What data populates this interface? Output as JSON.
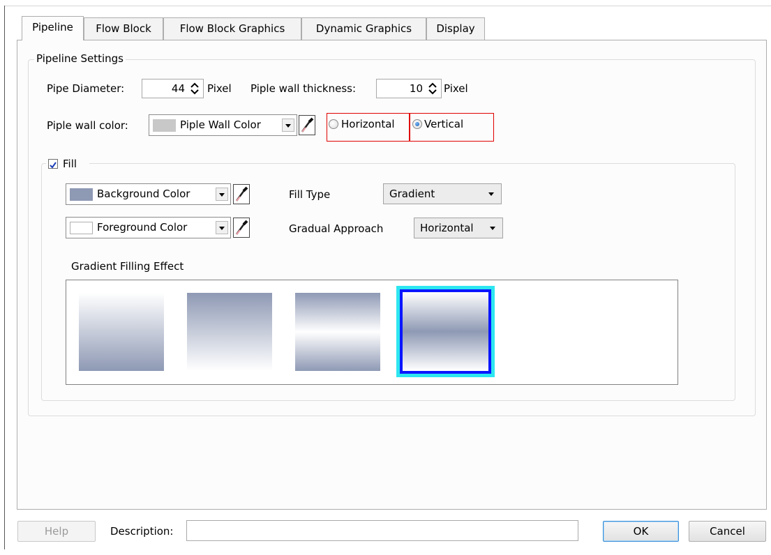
{
  "tabs": [
    "Pipeline",
    "Flow Block",
    "Flow Block Graphics",
    "Dynamic Graphics",
    "Display"
  ],
  "pipeline_settings": {
    "group_title": "Pipeline Settings",
    "pipe_diameter_label": "Pipe Diameter:",
    "pipe_diameter_value": "44",
    "pipe_diameter_unit": "Pixel",
    "wall_thickness_label": "Piple wall thickness:",
    "wall_thickness_value": "10",
    "wall_thickness_unit": "Pixel",
    "wall_color_label": "Piple wall color:",
    "wall_color_name": "Piple Wall Color",
    "wall_color_hex": "#c8c8c8",
    "orientation_options": [
      "Horizontal",
      "Vertical"
    ],
    "orientation_selected": "Vertical"
  },
  "fill": {
    "checkbox_label": "Fill",
    "checked": true,
    "background_color_label": "Background Color",
    "background_color_hex": "#8e99b4",
    "foreground_color_label": "Foreground Color",
    "foreground_color_hex": "#ffffff",
    "fill_type_label": "Fill Type",
    "fill_type_value": "Gradient",
    "gradual_approach_label": "Gradual Approach",
    "gradual_approach_value": "Horizontal",
    "gradient_effect_label": "Gradient Filling Effect",
    "gradient_selected_index": 3
  },
  "footer": {
    "help_label": "Help",
    "description_label": "Description:",
    "description_value": "",
    "ok_label": "OK",
    "cancel_label": "Cancel"
  },
  "colors": {
    "selection_outer": "#2ee6f0",
    "selection_inner": "#0a16ff",
    "highlight_box": "#e00000"
  }
}
